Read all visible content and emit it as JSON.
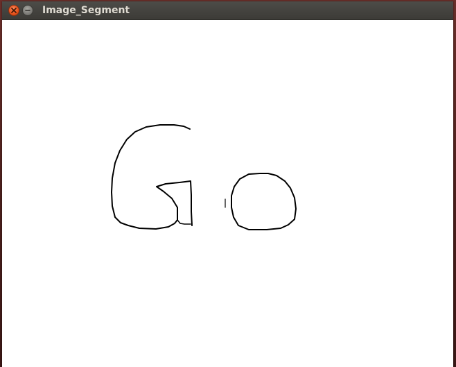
{
  "window": {
    "title": "Image_Segment",
    "controls": [
      {
        "name": "close",
        "icon": "close-icon",
        "color": "#e9541e"
      },
      {
        "name": "minimize",
        "icon": "minimize-icon",
        "color": "#7c7b77"
      }
    ]
  },
  "canvas": {
    "background": "#ffffff",
    "stroke_color": "#000000",
    "content": "segmented-contour-image"
  }
}
